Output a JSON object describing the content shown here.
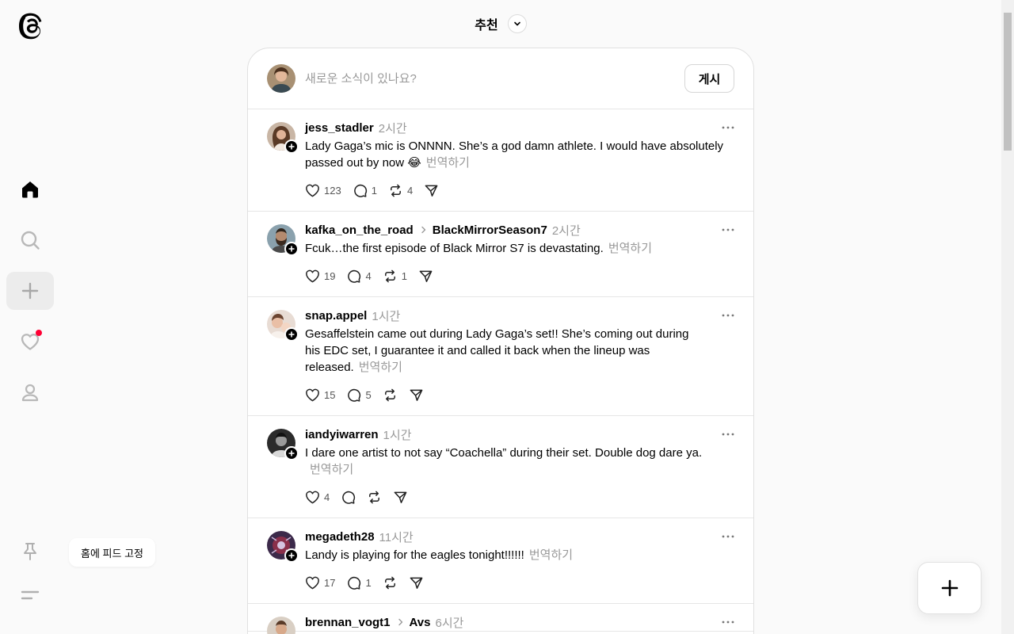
{
  "header": {
    "feed_title": "추천"
  },
  "composer": {
    "placeholder": "새로운 소식이 있나요?",
    "post_label": "게시"
  },
  "sidebar": {
    "pin_tooltip": "홈에 피드 고정",
    "items": [
      {
        "name": "home",
        "icon": "home-icon",
        "active": true
      },
      {
        "name": "search",
        "icon": "search-icon"
      },
      {
        "name": "create",
        "icon": "plus-icon"
      },
      {
        "name": "activity",
        "icon": "heart-icon",
        "has_notification": true
      },
      {
        "name": "profile",
        "icon": "person-icon"
      }
    ]
  },
  "posts": [
    {
      "username": "jess_stadler",
      "time": "2시간",
      "text": "Lady Gaga’s mic is ONNNN. She’s a god damn athlete. I would have absolutely passed out by now 😂",
      "translate": "번역하기",
      "likes": "123",
      "replies": "1",
      "reposts": "4"
    },
    {
      "username": "kafka_on_the_road",
      "community": "BlackMirrorSeason7",
      "time": "2시간",
      "text": "Fcuk…the first episode of Black Mirror S7 is devastating.",
      "translate": "번역하기",
      "likes": "19",
      "replies": "4",
      "reposts": "1"
    },
    {
      "username": "snap.appel",
      "time": "1시간",
      "text": "Gesaffelstein came out during Lady Gaga’s set!! She’s coming out during his EDC set, I guarantee it and called it back when the lineup was released.",
      "translate": "번역하기",
      "likes": "15",
      "replies": "5",
      "reposts": ""
    },
    {
      "username": "iandyiwarren",
      "time": "1시간",
      "text": "I dare one artist to not say “Coachella” during their set. Double dog dare ya.",
      "translate": "번역하기",
      "likes": "4",
      "replies": "",
      "reposts": ""
    },
    {
      "username": "megadeth28",
      "time": "11시간",
      "text": "Landy is playing for the eagles tonight!!!!!!",
      "translate": "번역하기",
      "likes": "17",
      "replies": "1",
      "reposts": ""
    },
    {
      "username": "brennan_vogt1",
      "community": "Avs",
      "time": "6시간",
      "text": "",
      "translate": "",
      "likes": "",
      "replies": "",
      "reposts": ""
    }
  ],
  "colors": {
    "accent": "#000000",
    "muted": "#999999",
    "notification": "#ff0034",
    "background": "#fafafa"
  }
}
